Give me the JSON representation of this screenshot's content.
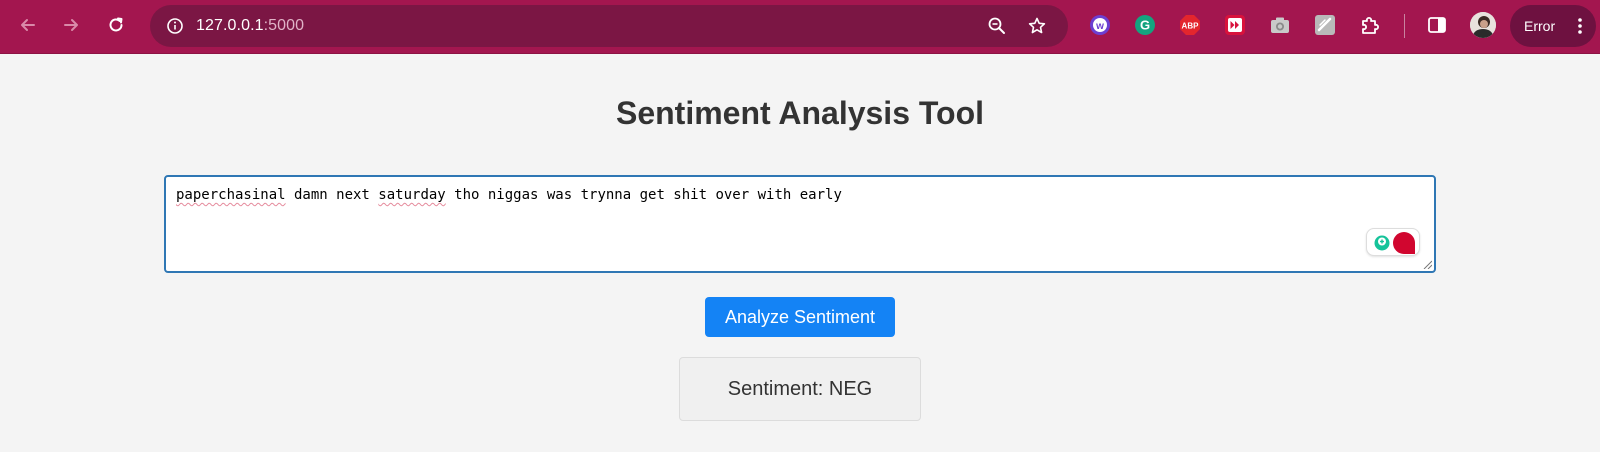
{
  "browser": {
    "url_host": "127.0.0.1",
    "url_port": ":5000",
    "profile_status": "Error",
    "nav": {
      "back": "arrow-left-icon",
      "forward": "arrow-right-icon",
      "reload": "reload-icon"
    },
    "extensions": [
      "wordtune-icon",
      "grammarly-icon",
      "adblock-plus-icon",
      "video-speed-icon",
      "camera-icon",
      "stylus-icon",
      "puzzle-icon"
    ],
    "colors": {
      "toolbar": "#a3164f",
      "omnibox": "#7b1644"
    }
  },
  "page": {
    "title": "Sentiment Analysis Tool",
    "input": {
      "word_1": "paperchasinal",
      "text_mid": " damn next ",
      "word_2": "saturday",
      "text_end": " tho niggas was trynna get shit over with early"
    },
    "analyze_button": "Analyze Sentiment",
    "result": "Sentiment: NEG",
    "colors": {
      "button": "#1483f5",
      "textarea_focus": "#2f77b4"
    }
  }
}
